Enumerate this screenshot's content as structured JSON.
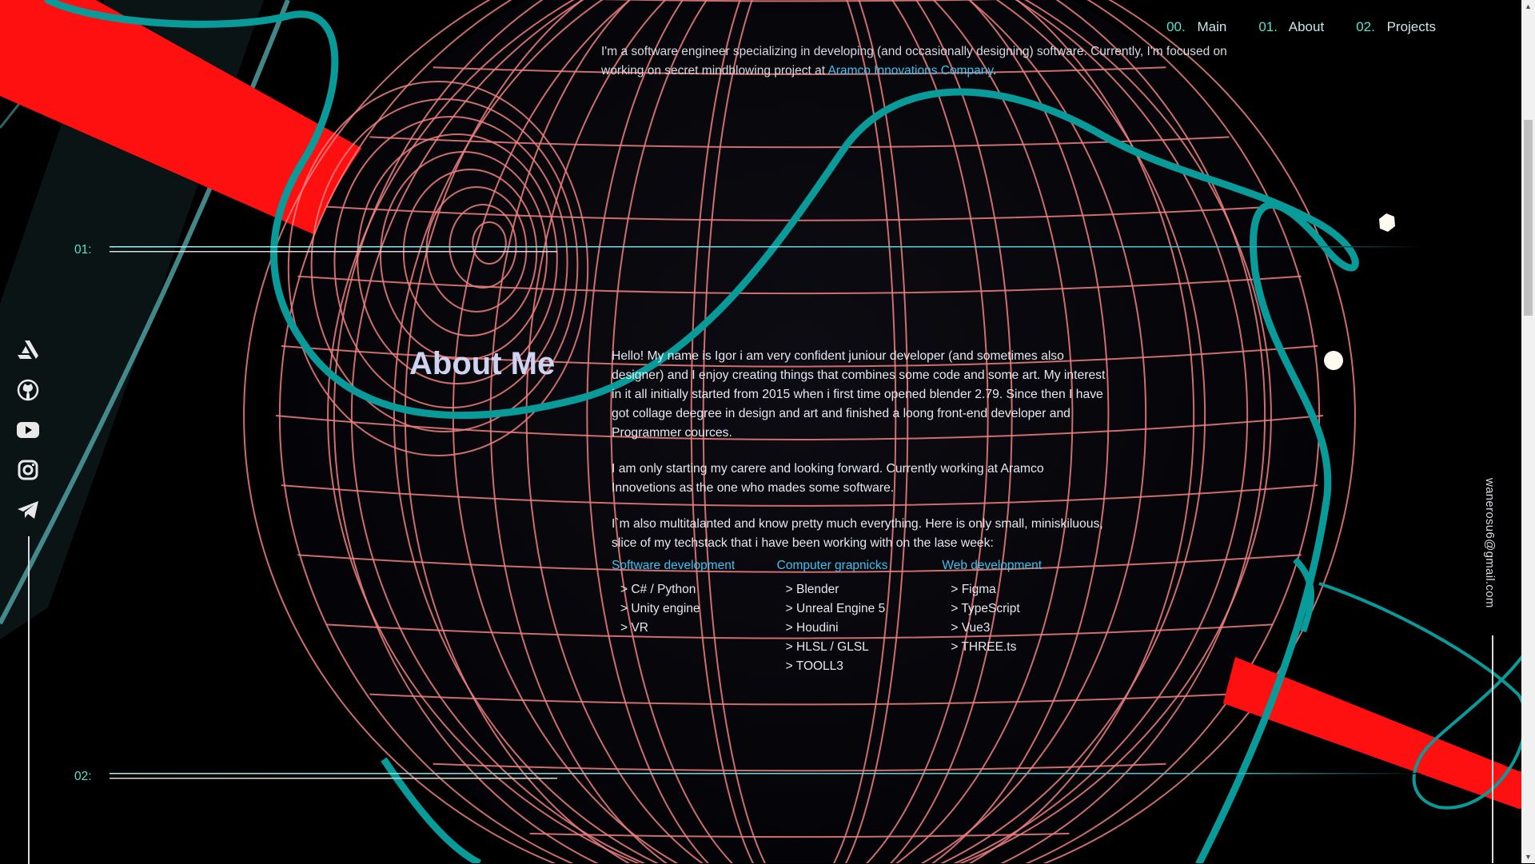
{
  "nav": [
    {
      "num": "00.",
      "label": "Main"
    },
    {
      "num": "01.",
      "label": "About"
    },
    {
      "num": "02.",
      "label": "Projects"
    }
  ],
  "intro": {
    "text": "I'm a software engineer specializing in developing (and occasionally designing) software. Currently, I'm focused on working on secret mindblowing project at ",
    "link": "Aramco Innovations Company",
    "end": "."
  },
  "sections": {
    "about_num": "01:",
    "projects_num": "02:"
  },
  "about": {
    "title": "About Me",
    "p1": "Hello! My name is Igor i am very confident juniour developer (and sometimes also designer) and I enjoy creating things that combines some code and some art. My interest in it all initially started from 2015 when i first time opened blender 2.79. Since then I have got collage deegree in design and art and finished a loong front-end developer and Programmer cources.",
    "p2": "I am only starting my carere and looking forward. Currently working at Aramco Innovetions as the one who mades some software.",
    "p3": "I`m also multitalanted and know pretty much everything. Here is only small, miniskiluous, slice of my techstack that i have been working with on the lase week:"
  },
  "techstack": [
    {
      "title": "Software development",
      "items": [
        "> C# / Python",
        "> Unity engine",
        "> VR"
      ]
    },
    {
      "title": "Computer grapnicks",
      "items": [
        "> Blender",
        "> Unreal Engine 5",
        "> Houdini",
        "> HLSL / GLSL",
        "> TOOLL3"
      ]
    },
    {
      "title": "Web development",
      "items": [
        "> Figma",
        "> TypeScript",
        "> Vue3",
        "> THREE.ts"
      ]
    }
  ],
  "social": [
    "artstation-icon",
    "github-icon",
    "youtube-icon",
    "instagram-icon",
    "telegram-icon"
  ],
  "email": "wanerosu6@gmail.com",
  "colors": {
    "accent": "#55e2cf",
    "link": "#3bc3f2",
    "wire": "#f08080",
    "tube": "#099a9a",
    "stripe": "#ff1010"
  }
}
